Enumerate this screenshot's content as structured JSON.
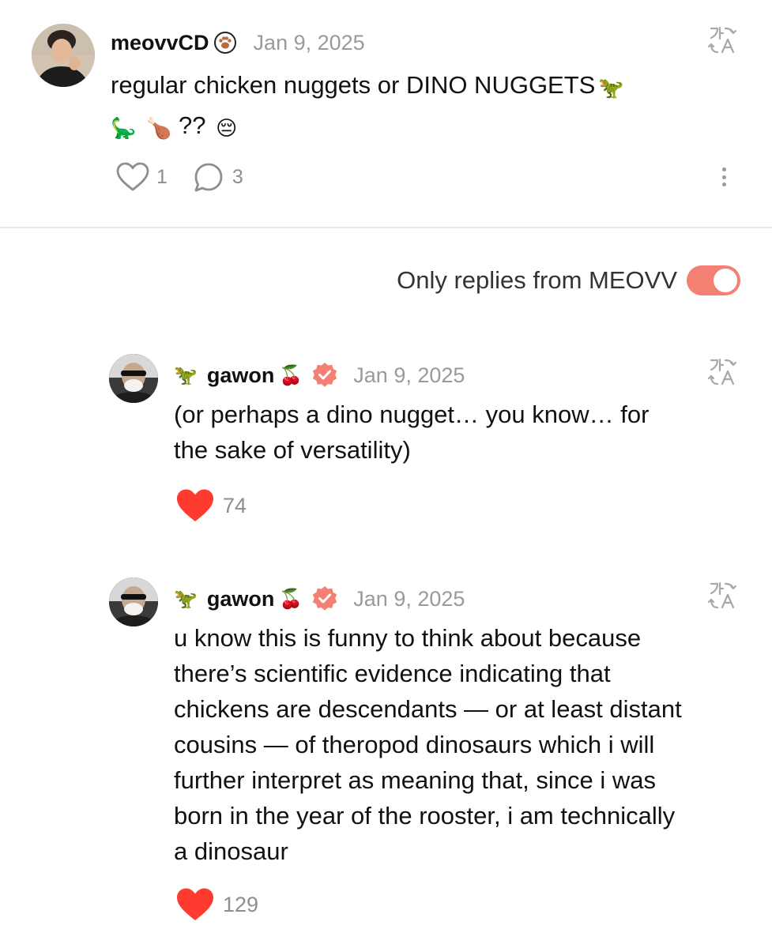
{
  "post": {
    "username": "meovvCD",
    "badge_icon": "paw-icon",
    "date": "Jan 9, 2025",
    "text_line1": "regular chicken nuggets or DINO NUGGETS",
    "text_line1_emoji": "🦖",
    "text_line2_emoji1": "🦕",
    "text_line2_emoji2": "🍗",
    "text_line2_mid": "??",
    "text_line2_emoji3": "😔",
    "like_count": "1",
    "reply_count": "3"
  },
  "filter": {
    "label": "Only replies from MEOVV",
    "enabled": true,
    "accent_color": "#f47f73"
  },
  "replies": [
    {
      "lead_emoji": "🦖",
      "username": "gawon",
      "name_emoji": "🍒",
      "date": "Jan 9, 2025",
      "text": "(or perhaps a dino nugget… you know… for the sake of versatility)",
      "like_count": "74",
      "liked": true
    },
    {
      "lead_emoji": "🦖",
      "username": "gawon",
      "name_emoji": "🍒",
      "date": "Jan 9, 2025",
      "text": "u know this is funny to think about because there’s scientific evidence indicating that chickens are descendants — or at least distant cousins — of theropod dinosaurs which i will further interpret as meaning that, since i was born in the year of the rooster, i am technically a dinosaur",
      "like_count": "129",
      "liked": true
    }
  ],
  "colors": {
    "heart_red": "#ff3b30",
    "verified": "#f47f73",
    "muted_text": "#9a9a9a"
  }
}
